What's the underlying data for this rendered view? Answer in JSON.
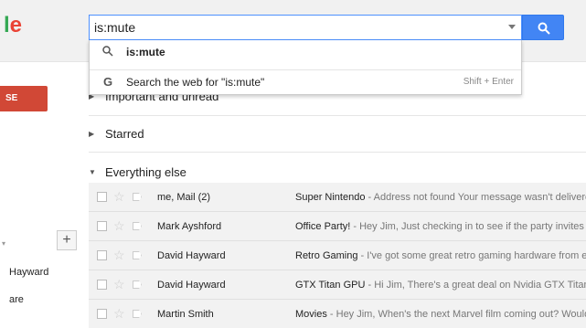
{
  "logo": {
    "text1": "l",
    "text2": "e"
  },
  "search": {
    "value": "is:mute"
  },
  "suggestions": {
    "item1": {
      "text": "is:mute"
    },
    "item2": {
      "text": "Search the web for \"is:mute\"",
      "hint": "Shift + Enter"
    }
  },
  "sidebar": {
    "compose_label": "SE",
    "plus_label": "+",
    "names": [
      "Hayward",
      "are"
    ]
  },
  "sections": {
    "important": "Important and unread",
    "starred": "Starred",
    "everything": "Everything else"
  },
  "emails": [
    {
      "sender": "me, Mail (2)",
      "subject": "Super Nintendo",
      "snippet": " - Address not found Your message wasn't delivered to"
    },
    {
      "sender": "Mark Ayshford",
      "subject": "Office Party!",
      "snippet": " - Hey Jim, Just checking in to see if the party invites have"
    },
    {
      "sender": "David Hayward",
      "subject": "Retro Gaming",
      "snippet": " - I've got some great retro gaming hardware from eBay"
    },
    {
      "sender": "David Hayward",
      "subject": "GTX Titan GPU",
      "snippet": " - Hi Jim, There's a great deal on Nvidia GTX Titan gra"
    },
    {
      "sender": "Martin Smith",
      "subject": "Movies",
      "snippet": " - Hey Jim, When's the next Marvel film coming out? Would be"
    }
  ],
  "colors": {
    "accent": "#4285f4",
    "compose": "#d14836"
  }
}
